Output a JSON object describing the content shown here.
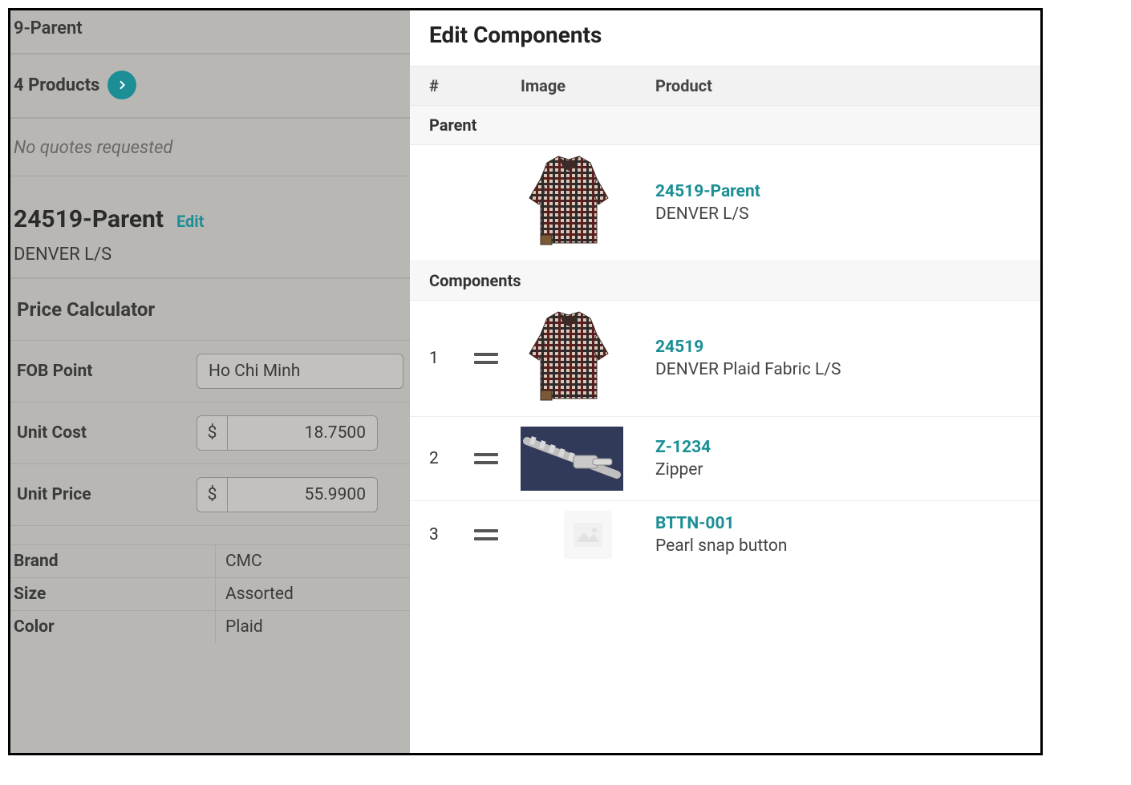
{
  "left": {
    "header": "9-Parent",
    "products_label": "4 Products",
    "no_quotes": "No quotes requested",
    "product_code": "24519-Parent",
    "edit_label": "Edit",
    "product_name": "DENVER L/S",
    "price_calc": {
      "heading": "Price Calculator",
      "fob_label": "FOB Point",
      "fob_value": "Ho Chi Minh",
      "unit_cost_label": "Unit Cost",
      "unit_cost_currency": "$",
      "unit_cost_value": "18.7500",
      "unit_price_label": "Unit Price",
      "unit_price_currency": "$",
      "unit_price_value": "55.9900"
    },
    "attrs": {
      "brand_k": "Brand",
      "brand_v": "CMC",
      "size_k": "Size",
      "size_v": "Assorted",
      "color_k": "Color",
      "color_v": "Plaid"
    }
  },
  "right": {
    "title": "Edit Components",
    "cols": {
      "num": "#",
      "image": "Image",
      "product": "Product"
    },
    "sections": {
      "parent": "Parent",
      "components": "Components"
    },
    "parent": {
      "code": "24519-Parent",
      "desc": "DENVER L/S"
    },
    "components": [
      {
        "num": "1",
        "code": "24519",
        "desc": "DENVER Plaid Fabric L/S",
        "image": "shirt"
      },
      {
        "num": "2",
        "code": "Z-1234",
        "desc": "Zipper",
        "image": "zipper"
      },
      {
        "num": "3",
        "code": "BTTN-001",
        "desc": "Pearl snap button",
        "image": "placeholder"
      }
    ]
  }
}
